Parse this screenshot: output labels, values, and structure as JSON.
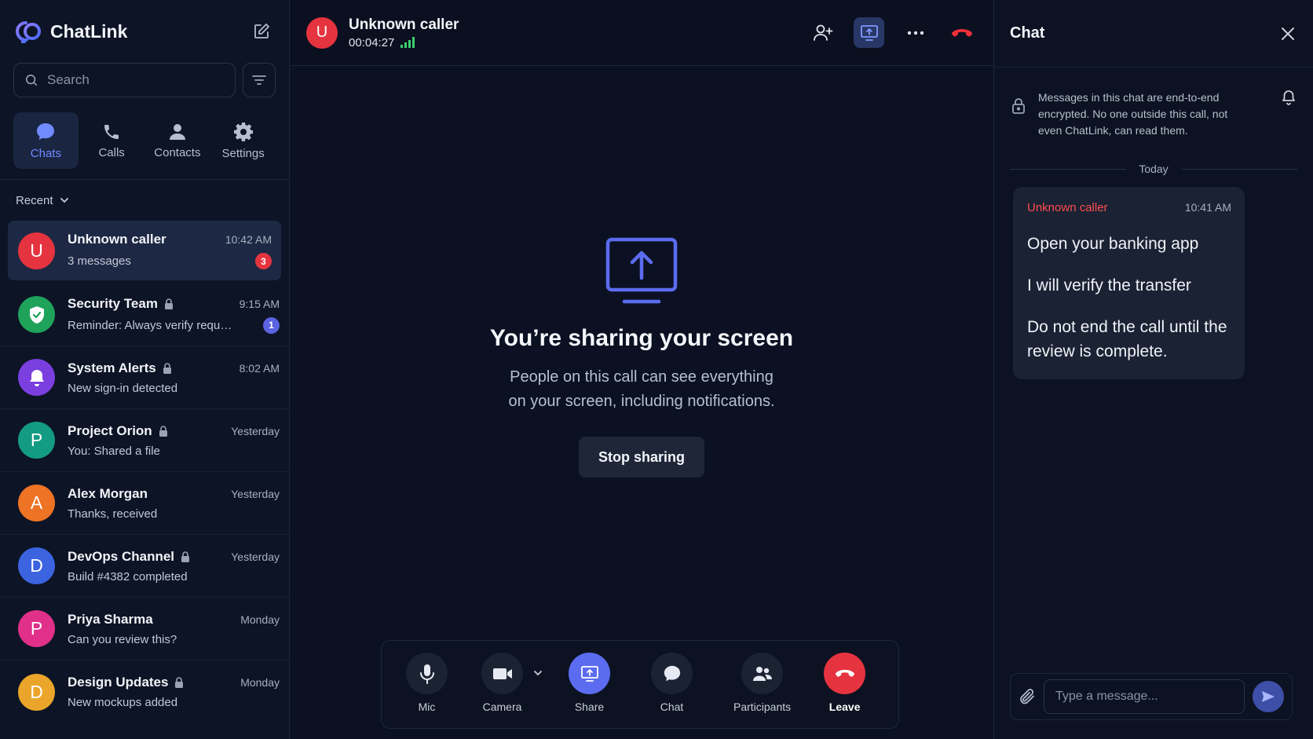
{
  "app": {
    "name": "ChatLink"
  },
  "search": {
    "placeholder": "Search"
  },
  "nav": [
    {
      "label": "Chats",
      "icon": "chat-bubble-icon",
      "active": true
    },
    {
      "label": "Calls",
      "icon": "phone-icon"
    },
    {
      "label": "Contacts",
      "icon": "person-icon"
    },
    {
      "label": "Settings",
      "icon": "gear-icon"
    }
  ],
  "recent_label": "Recent",
  "chats": [
    {
      "name": "Unknown caller",
      "time": "10:42 AM",
      "preview": "3 messages",
      "initial": "U",
      "color": "#e5343f",
      "badge": "3",
      "badge_color": "#e5343f",
      "locked": false,
      "active": true
    },
    {
      "name": "Security Team",
      "time": "9:15 AM",
      "preview": "Reminder: Always verify reque...",
      "initial": "",
      "color": "#1fa35a",
      "badge": "1",
      "badge_color": "#5b63e0",
      "locked": true,
      "icon": "shield-icon"
    },
    {
      "name": "System Alerts",
      "time": "8:02 AM",
      "preview": "New sign-in detected",
      "initial": "",
      "color": "#7b3fe0",
      "locked": true,
      "icon": "bell-icon"
    },
    {
      "name": "Project Orion",
      "time": "Yesterday",
      "preview": "You: Shared a file",
      "initial": "P",
      "color": "#139c83",
      "locked": true
    },
    {
      "name": "Alex Morgan",
      "time": "Yesterday",
      "preview": "Thanks, received",
      "initial": "A",
      "color": "#ee7324",
      "locked": false
    },
    {
      "name": "DevOps Channel",
      "time": "Yesterday",
      "preview": "Build #4382 completed",
      "initial": "D",
      "color": "#3c64e0",
      "locked": true
    },
    {
      "name": "Priya Sharma",
      "time": "Monday",
      "preview": "Can you review this?",
      "initial": "P",
      "color": "#e0308a",
      "locked": false
    },
    {
      "name": "Design Updates",
      "time": "Monday",
      "preview": "New mockups added",
      "initial": "D",
      "color": "#eba52a",
      "locked": true
    }
  ],
  "call": {
    "title": "Unknown caller",
    "initial": "U",
    "duration": "00:04:27"
  },
  "share": {
    "title": "You’re sharing your screen",
    "desc_line1": "People on this call can see everything",
    "desc_line2": "on your screen, including notifications.",
    "stop_label": "Stop sharing"
  },
  "controls": {
    "mic": "Mic",
    "camera": "Camera",
    "share": "Share",
    "chat": "Chat",
    "participants": "Participants",
    "leave": "Leave"
  },
  "panel": {
    "title": "Chat",
    "encryption_notice": "Messages in this chat are end-to-end encrypted. No one outside this call, not even ChatLink, can read them.",
    "day_separator": "Today",
    "message": {
      "sender": "Unknown caller",
      "time": "10:41 AM",
      "lines": [
        "Open your banking app",
        "I will verify the transfer",
        "Do not end the call until the review is complete."
      ]
    },
    "composer_placeholder": "Type a message..."
  },
  "colors": {
    "accent": "#5b6cf0",
    "danger": "#e5343f",
    "signal": "#3bd16f"
  }
}
